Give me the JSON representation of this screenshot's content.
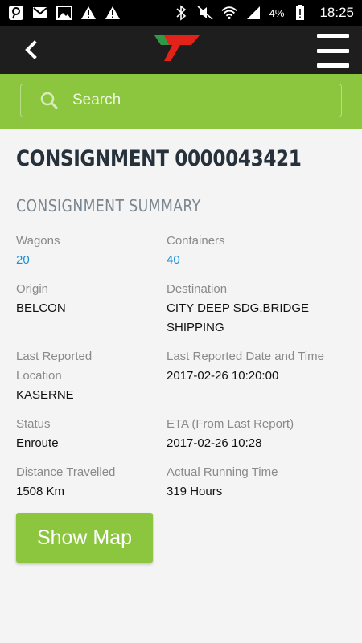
{
  "status_bar": {
    "battery_percent": "4%",
    "time": "18:25"
  },
  "search": {
    "placeholder": "Search"
  },
  "page": {
    "title": "CONSIGNMENT 0000043421",
    "section_title": "CONSIGNMENT SUMMARY"
  },
  "fields": {
    "wagons": {
      "label": "Wagons",
      "value": "20"
    },
    "containers": {
      "label": "Containers",
      "value": "40"
    },
    "origin": {
      "label": "Origin",
      "value": "BELCON"
    },
    "destination": {
      "label": "Destination",
      "value": "CITY DEEP SDG.BRIDGE SHIPPING"
    },
    "last_location": {
      "label": "Last Reported Location",
      "value": "KASERNE"
    },
    "last_datetime": {
      "label": "Last Reported Date and Time",
      "value": "2017-02-26 10:20:00"
    },
    "status": {
      "label": "Status",
      "value": "Enroute"
    },
    "eta": {
      "label": "ETA (From Last Report)",
      "value": "2017-02-26 10:28"
    },
    "distance": {
      "label": "Distance Travelled",
      "value": "1508 Km"
    },
    "running_time": {
      "label": "Actual Running Time",
      "value": "319 Hours"
    }
  },
  "actions": {
    "show_map": "Show Map"
  },
  "colors": {
    "accent_green": "#8cc63f",
    "link_blue": "#1f8ed6",
    "logo_red": "#e2231a"
  }
}
